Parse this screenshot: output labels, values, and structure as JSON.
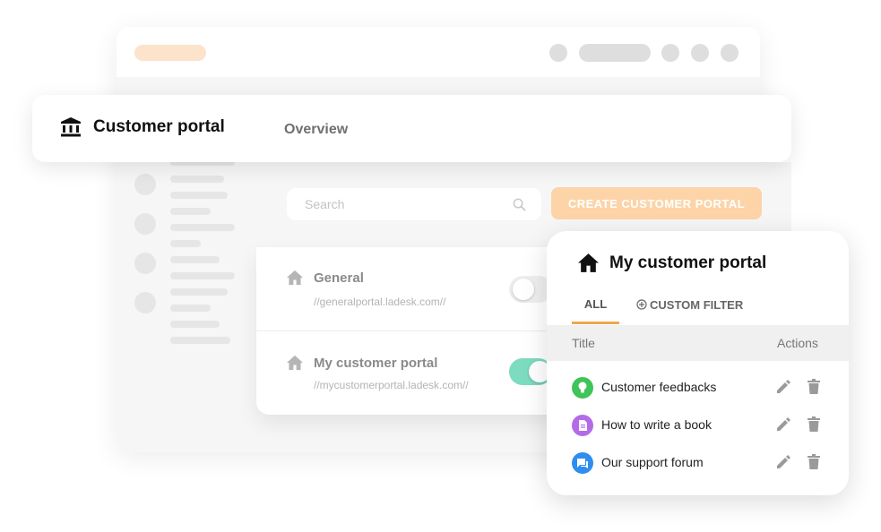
{
  "header": {
    "title": "Customer portal",
    "nav_label": "Overview"
  },
  "toolbar": {
    "search_placeholder": "Search",
    "create_label": "CREATE CUSTOMER PORTAL"
  },
  "portals": [
    {
      "name": "General",
      "url": "//generalportal.ladesk.com//",
      "enabled": false
    },
    {
      "name": "My customer portal",
      "url": "//mycustomerportal.ladesk.com//",
      "enabled": true
    }
  ],
  "card": {
    "title": "My customer portal",
    "tabs": {
      "all": "ALL",
      "custom_filter": "CUSTOM FILTER"
    },
    "columns": {
      "title": "Title",
      "actions": "Actions"
    },
    "rows": [
      {
        "title": "Customer feedbacks",
        "icon": "lightbulb-icon",
        "color": "#3fc45a"
      },
      {
        "title": "How to write a book",
        "icon": "document-icon",
        "color": "#b46be8"
      },
      {
        "title": "Our support forum",
        "icon": "chat-icon",
        "color": "#2d8ef0"
      }
    ]
  },
  "colors": {
    "accent": "#f0a650",
    "button": "#fcd4a8",
    "toggle_on": "#7ddcc0",
    "toggle_off": "#eeeeee"
  }
}
